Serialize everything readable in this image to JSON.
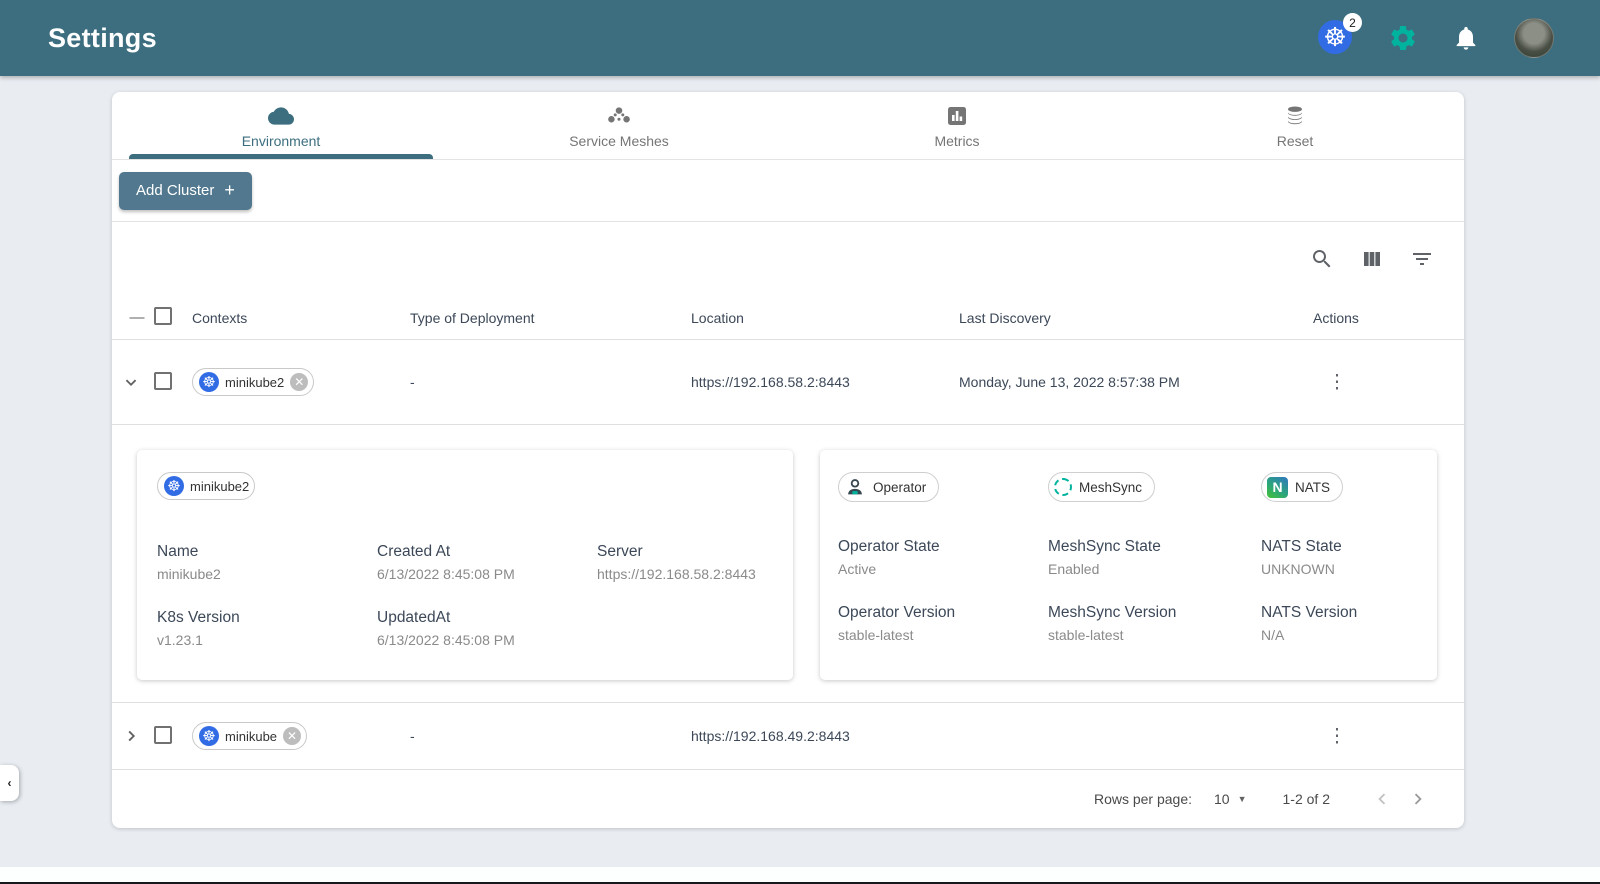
{
  "header": {
    "title": "Settings",
    "k8s_badge_count": "2",
    "icons": [
      "kubernetes-icon",
      "settings-gear-icon",
      "notifications-bell-icon",
      "user-avatar"
    ]
  },
  "colors": {
    "header_bg": "#3c6e7f",
    "accent_green": "#00b39f",
    "k8s_blue": "#326ce5",
    "active_tab": "#3c6e7f",
    "button_bg": "#51788e"
  },
  "tabs": [
    {
      "label": "Environment",
      "icon": "cloud-icon",
      "active": true
    },
    {
      "label": "Service Meshes",
      "icon": "service-mesh-icon",
      "active": false
    },
    {
      "label": "Metrics",
      "icon": "bar-chart-icon",
      "active": false
    },
    {
      "label": "Reset",
      "icon": "database-icon",
      "active": false
    }
  ],
  "actions_bar": {
    "add_cluster_label": "Add Cluster",
    "plus_sign": "+"
  },
  "table_toolbar": {
    "icons": [
      "search-icon",
      "view-columns-icon",
      "filter-icon"
    ]
  },
  "table": {
    "columns": [
      "Contexts",
      "Type of Deployment",
      "Location",
      "Last Discovery",
      "Actions"
    ],
    "rows": [
      {
        "context": "minikube2",
        "type_of_deployment": "-",
        "location": "https://192.168.58.2:8443",
        "last_discovery": "Monday, June 13, 2022 8:57:38 PM",
        "expanded": true
      },
      {
        "context": "minikube",
        "type_of_deployment": "-",
        "location": "https://192.168.49.2:8443",
        "last_discovery": "",
        "expanded": false
      }
    ]
  },
  "details": {
    "context_chip": "minikube2",
    "left_fields": [
      {
        "label": "Name",
        "value": "minikube2"
      },
      {
        "label": "Created At",
        "value": "6/13/2022 8:45:08 PM"
      },
      {
        "label": "Server",
        "value": "https://192.168.58.2:8443"
      },
      {
        "label": "K8s Version",
        "value": "v1.23.1"
      },
      {
        "label": "UpdatedAt",
        "value": "6/13/2022 8:45:08 PM"
      }
    ],
    "service_chips": [
      {
        "label": "Operator",
        "icon": "operator-person-icon"
      },
      {
        "label": "MeshSync",
        "icon": "meshsync-dashed-circle-icon"
      },
      {
        "label": "NATS",
        "icon": "nats-logo-icon",
        "letter": "N"
      }
    ],
    "right_fields": [
      {
        "label": "Operator State",
        "value": "Active"
      },
      {
        "label": "MeshSync State",
        "value": "Enabled"
      },
      {
        "label": "NATS State",
        "value": "UNKNOWN"
      },
      {
        "label": "Operator Version",
        "value": "stable-latest"
      },
      {
        "label": "MeshSync Version",
        "value": "stable-latest"
      },
      {
        "label": "NATS Version",
        "value": "N/A"
      }
    ]
  },
  "pagination": {
    "rows_per_page_label": "Rows per page:",
    "rows_per_page_value": "10",
    "range": "1-2 of 2"
  }
}
